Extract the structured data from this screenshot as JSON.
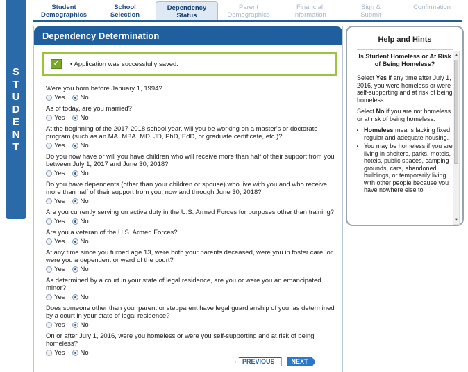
{
  "side_label": [
    "S",
    "T",
    "U",
    "D",
    "E",
    "N",
    "T"
  ],
  "steps": [
    {
      "line1": "Student",
      "line2": "Demographics",
      "state": "done"
    },
    {
      "line1": "School",
      "line2": "Selection",
      "state": "done"
    },
    {
      "line1": "Dependency",
      "line2": "Status",
      "state": "active"
    },
    {
      "line1": "Parent",
      "line2": "Demographics",
      "state": "disabled"
    },
    {
      "line1": "Financial",
      "line2": "Information",
      "state": "disabled"
    },
    {
      "line1": "Sign &",
      "line2": "Submit",
      "state": "disabled"
    },
    {
      "line1": "Confirmation",
      "line2": "",
      "state": "disabled"
    }
  ],
  "main": {
    "title": "Dependency Determination",
    "saved_message": "Application was successfully saved.",
    "yes_label": "Yes",
    "no_label": "No",
    "questions": [
      {
        "text": "Were you born before January 1, 1994?",
        "answer": "No"
      },
      {
        "text": "As of today, are you married?",
        "answer": "No"
      },
      {
        "text": "At the beginning of the 2017-2018 school year, will you be working on a master's or doctorate program (such as an MA, MBA, MD, JD, PhD, EdD, or graduate certificate, etc.)?",
        "answer": "No"
      },
      {
        "text": "Do you now have or will you have children who will receive more than half of their support from you between July 1, 2017 and June 30, 2018?",
        "answer": "No"
      },
      {
        "text": "Do you have dependents (other than your children or spouse) who live with you and who receive more than half of their support from you, now and through June 30, 2018?",
        "answer": "No"
      },
      {
        "text": "Are you currently serving on active duty in the U.S. Armed Forces for purposes other than training?",
        "answer": "No"
      },
      {
        "text": "Are you a veteran of the U.S. Armed Forces?",
        "answer": "No"
      },
      {
        "text": "At any time since you turned age 13, were both your parents deceased, were you in foster care, or were you a dependent or ward of the court?",
        "answer": "No"
      },
      {
        "text": "As determined by a court in your state of legal residence, are you or were you an emancipated minor?",
        "answer": "No"
      },
      {
        "text": "Does someone other than your parent or stepparent have legal guardianship of you, as determined by a court in your state of legal residence?",
        "answer": "No"
      },
      {
        "text": "On or after July 1, 2016, were you homeless or were you self-supporting and at risk of being homeless?",
        "answer": "No"
      }
    ],
    "previous_label": "PREVIOUS",
    "next_label": "NEXT"
  },
  "help": {
    "title": "Help and Hints",
    "subtitle": "Is Student Homeless or At Risk of Being Homeless?",
    "p1_pre": "Select ",
    "p1_bold": "Yes",
    "p1_post": " if any time after July 1, 2016, you were homeless or were self-supporting and at risk of being homeless.",
    "p2_pre": "Select ",
    "p2_bold": "No",
    "p2_post": " if you are not homeless or at risk of being homeless.",
    "b1_bold": "Homeless",
    "b1_post": " means lacking fixed, regular and adequate housing.",
    "b2": "You may be homeless if you are living in shelters, parks, motels, hotels, public spaces, camping grounds, cars, abandoned buildings, or temporarily living with other people because you have nowhere else to"
  }
}
